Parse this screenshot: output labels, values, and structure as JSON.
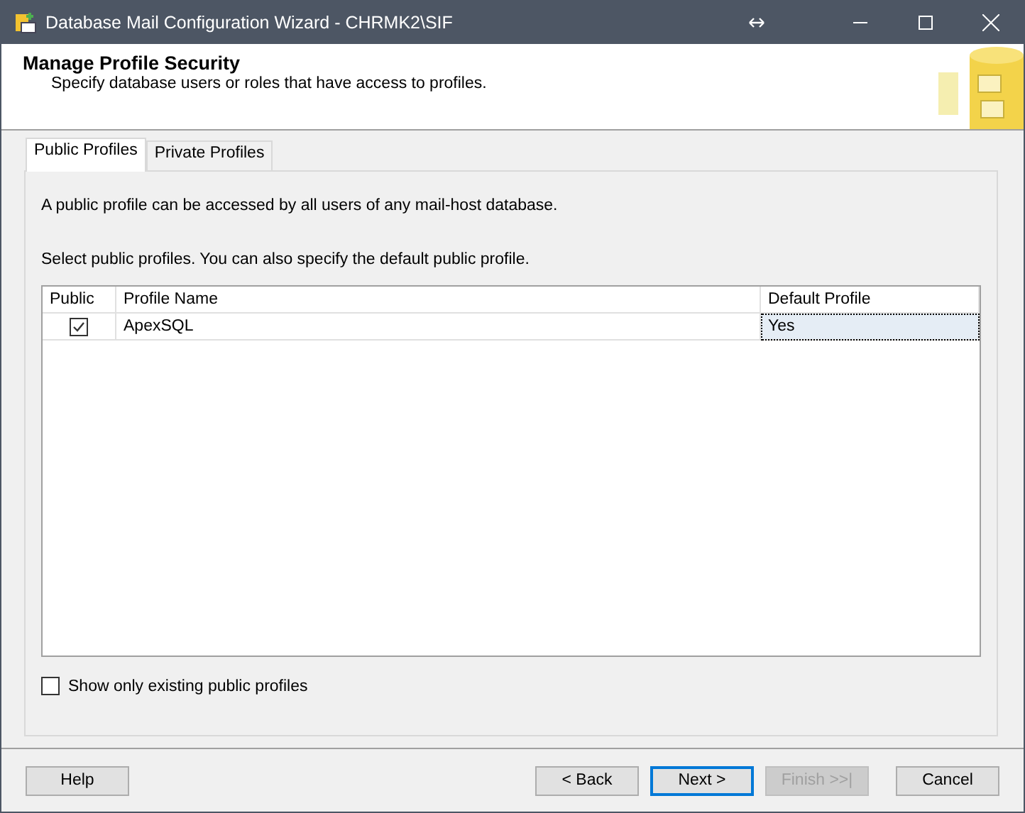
{
  "window": {
    "title": "Database Mail Configuration Wizard - CHRMK2\\SIF"
  },
  "header": {
    "title": "Manage Profile Security",
    "subtitle": "Specify database users or roles that have access to profiles."
  },
  "tabs": [
    {
      "label": "Public Profiles",
      "selected": true
    },
    {
      "label": "Private Profiles",
      "selected": false
    }
  ],
  "description": "A public profile can be accessed by all users of any mail-host database.",
  "instruction": "Select public profiles. You can also specify the default public profile.",
  "table": {
    "columns": [
      "Public",
      "Profile Name",
      "Default Profile"
    ],
    "rows": [
      {
        "public": true,
        "name": "ApexSQL",
        "default": "Yes",
        "selected": true
      }
    ]
  },
  "show_existing": {
    "label": "Show only existing public profiles",
    "checked": false
  },
  "buttons": [
    {
      "label": "Help",
      "disabled": false,
      "default": false
    },
    {
      "label": "< Back",
      "disabled": false,
      "default": false
    },
    {
      "label": "Next >",
      "disabled": false,
      "default": true
    },
    {
      "label": "Finish >>|",
      "disabled": true,
      "default": false
    },
    {
      "label": "Cancel",
      "disabled": false,
      "default": false
    }
  ]
}
